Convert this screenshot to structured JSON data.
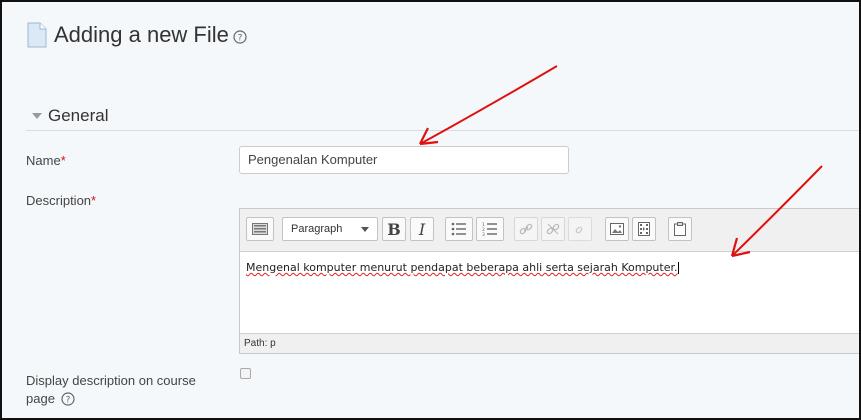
{
  "page": {
    "title": "Adding a new File"
  },
  "section": {
    "title": "General"
  },
  "form": {
    "name_label": "Name",
    "required_mark": "*",
    "name_value": "Pengenalan Komputer",
    "description_label": "Description",
    "display_label_line1": "Display description on course",
    "display_label_line2": "page",
    "display_checked": false
  },
  "editor": {
    "paragraph_select": "Paragraph",
    "bold_label": "B",
    "italic_label": "I",
    "content": "Mengenal komputer menurut pendapat beberapa ahli serta sejarah Komputer.",
    "path_label": "Path: p",
    "toolbar_icons": [
      "toolbar-toggle-icon",
      "bold-icon",
      "italic-icon",
      "unordered-list-icon",
      "ordered-list-icon",
      "link-icon",
      "unlink-icon",
      "anchor-icon",
      "image-icon",
      "media-icon",
      "paste-icon"
    ]
  },
  "colors": {
    "required": "#d0161d",
    "annotation_arrow": "#e01010",
    "background": "#f5f8fb"
  }
}
